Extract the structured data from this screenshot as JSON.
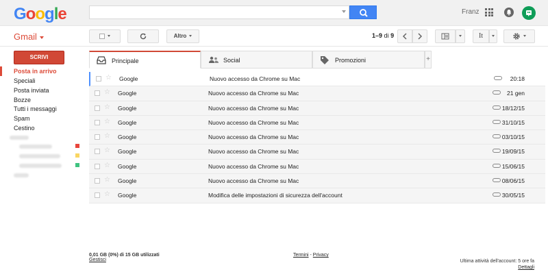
{
  "header": {
    "logo_letters": [
      "G",
      "o",
      "o",
      "g",
      "l",
      "e"
    ],
    "logo_colors": [
      "#4285f4",
      "#ea4335",
      "#fbbc05",
      "#4285f4",
      "#34a853",
      "#ea4335"
    ],
    "search_placeholder": "",
    "user_name": "Franz"
  },
  "toolbar": {
    "app_label": "Gmail",
    "more_label": "Altro",
    "pager_range": "1–9",
    "pager_of": "di",
    "pager_total": "9",
    "lang_label": "It"
  },
  "sidebar": {
    "compose_label": "SCRIVI",
    "items": [
      {
        "label": "Posta in arrivo",
        "active": true
      },
      {
        "label": "Speciali"
      },
      {
        "label": "Posta inviata"
      },
      {
        "label": "Bozze"
      },
      {
        "label": "Tutti i messaggi"
      },
      {
        "label": "Spam"
      },
      {
        "label": "Cestino"
      }
    ],
    "label_colors": [
      "#e8453c",
      "#f9d663",
      "#3fc380"
    ]
  },
  "tabs": [
    {
      "label": "Principale",
      "icon": "inbox-icon"
    },
    {
      "label": "Social",
      "icon": "people-icon"
    },
    {
      "label": "Promozioni",
      "icon": "tag-icon"
    }
  ],
  "tab_add_label": "+",
  "emails": [
    {
      "sender": "Google",
      "subject": "Nuovo accesso da Chrome su Mac",
      "date": "20:18"
    },
    {
      "sender": "Google",
      "subject": "Nuovo accesso da Chrome su Mac",
      "date": "21 gen"
    },
    {
      "sender": "Google",
      "subject": "Nuovo accesso da Chrome su Mac",
      "date": "18/12/15"
    },
    {
      "sender": "Google",
      "subject": "Nuovo accesso da Chrome su Mac",
      "date": "31/10/15"
    },
    {
      "sender": "Google",
      "subject": "Nuovo accesso da Chrome su Mac",
      "date": "03/10/15"
    },
    {
      "sender": "Google",
      "subject": "Nuovo accesso da Chrome su Mac",
      "date": "19/09/15"
    },
    {
      "sender": "Google",
      "subject": "Nuovo accesso da Chrome su Mac",
      "date": "15/06/15"
    },
    {
      "sender": "Google",
      "subject": "Nuovo accesso da Chrome su Mac",
      "date": "08/06/15"
    },
    {
      "sender": "Google",
      "subject": "Modifica delle impostazioni di sicurezza dell'account",
      "date": "30/05/15"
    }
  ],
  "footer": {
    "storage": "0,01 GB (0%) di 15 GB utilizzati",
    "manage": "Gestisci",
    "terms": "Termini",
    "separator": " - ",
    "privacy": "Privacy",
    "last_activity": "Ultima attività dell'account: 5 ore fa",
    "details": "Dettagli"
  }
}
